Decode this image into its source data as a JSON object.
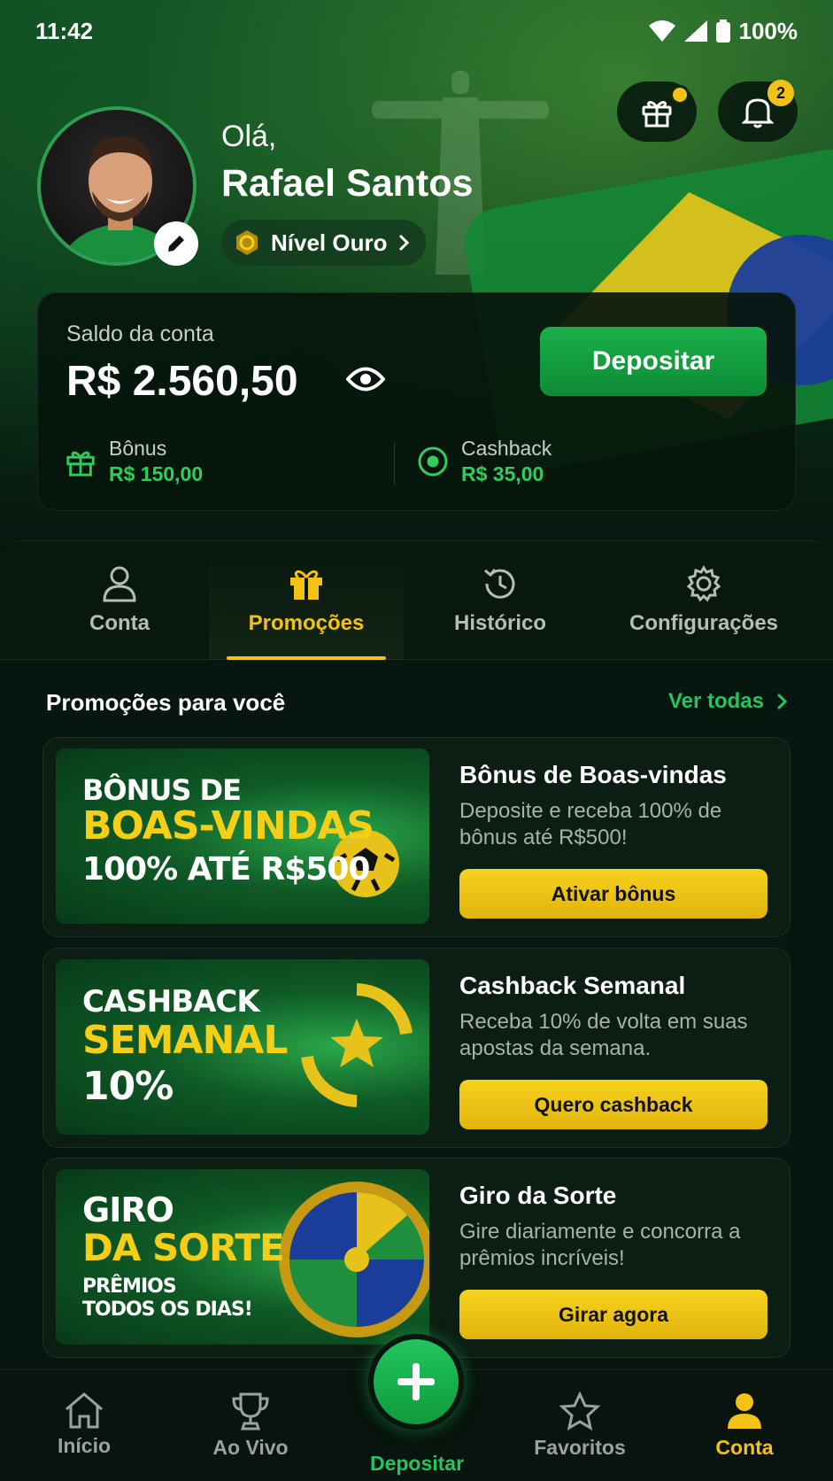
{
  "status_bar": {
    "time": "11:42",
    "battery": "100%"
  },
  "header": {
    "notification_count": "2",
    "greeting": "Olá,",
    "user_name": "Rafael Santos",
    "level_label": "Nível Ouro"
  },
  "balance": {
    "label": "Saldo da conta",
    "value": "R$ 2.560,50",
    "deposit_label": "Depositar",
    "bonus_label": "Bônus",
    "bonus_value": "R$ 150,00",
    "cashback_label": "Cashback",
    "cashback_value": "R$ 35,00"
  },
  "tabs": [
    {
      "label": "Conta",
      "icon": "user-icon"
    },
    {
      "label": "Promoções",
      "icon": "gift-icon",
      "active": true
    },
    {
      "label": "Histórico",
      "icon": "history-icon"
    },
    {
      "label": "Configurações",
      "icon": "gear-icon"
    }
  ],
  "section": {
    "title": "Promoções para você",
    "see_all": "Ver todas"
  },
  "promos": [
    {
      "image_lines": [
        "BÔNUS DE",
        "BOAS-VINDAS",
        "100% ATÉ R$500"
      ],
      "title": "Bônus de Boas-vindas",
      "desc": "Deposite e receba 100% de bônus até R$500!",
      "button": "Ativar bônus"
    },
    {
      "image_lines": [
        "CASHBACK",
        "SEMANAL",
        "10%"
      ],
      "title": "Cashback Semanal",
      "desc": "Receba 10% de volta em suas apostas da semana.",
      "button": "Quero cashback"
    },
    {
      "image_lines": [
        "GIRO",
        "DA SORTE",
        "PRÊMIOS",
        "TODOS OS DIAS!"
      ],
      "title": "Giro da Sorte",
      "desc": "Gire diariamente e concorra a prêmios incríveis!",
      "button": "Girar agora"
    }
  ],
  "bottom_nav": [
    {
      "label": "Início",
      "icon": "home-icon"
    },
    {
      "label": "Ao Vivo",
      "icon": "trophy-icon"
    },
    {
      "label": "Depositar",
      "icon": "plus-icon"
    },
    {
      "label": "Favoritos",
      "icon": "star-icon"
    },
    {
      "label": "Conta",
      "icon": "user-icon",
      "active": true
    }
  ],
  "colors": {
    "accent_green": "#22c55e",
    "accent_yellow": "#f2c314",
    "background": "#07170f"
  }
}
